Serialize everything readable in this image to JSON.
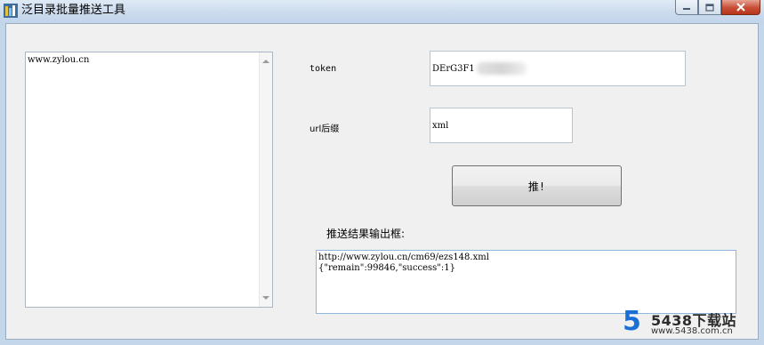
{
  "window": {
    "title": "泛目录批量推送工具"
  },
  "list": {
    "items": [
      "www.zylou.cn"
    ]
  },
  "form": {
    "token_label": "token",
    "token_value": "DErG3F1",
    "url_suffix_label": "url后缀",
    "url_suffix_value": "xml",
    "push_button_label": "推!"
  },
  "result": {
    "label": "推送结果输出框:",
    "lines": [
      "http://www.zylou.cn/cm69/ezs148.xml",
      "{\"remain\":99846,\"success\":1}"
    ]
  },
  "watermark": {
    "logo": "5",
    "brand": "5438下载站",
    "url": "www.5438.com.cn"
  },
  "colors": {
    "titlebar": "#cddcee",
    "client_bg": "#f0f0f0",
    "close_button": "#c74d35",
    "result_border": "#8fb7dd",
    "watermark_blue": "#1a6fd4"
  }
}
